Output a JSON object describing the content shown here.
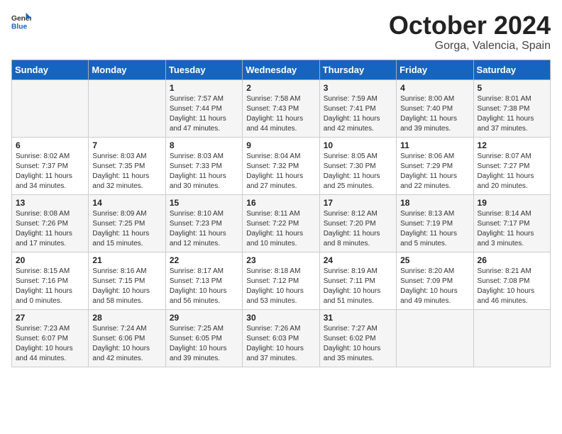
{
  "header": {
    "logo_general": "General",
    "logo_blue": "Blue",
    "month": "October 2024",
    "location": "Gorga, Valencia, Spain"
  },
  "weekdays": [
    "Sunday",
    "Monday",
    "Tuesday",
    "Wednesday",
    "Thursday",
    "Friday",
    "Saturday"
  ],
  "weeks": [
    [
      {
        "day": "",
        "content": ""
      },
      {
        "day": "",
        "content": ""
      },
      {
        "day": "1",
        "content": "Sunrise: 7:57 AM\nSunset: 7:44 PM\nDaylight: 11 hours and 47 minutes."
      },
      {
        "day": "2",
        "content": "Sunrise: 7:58 AM\nSunset: 7:43 PM\nDaylight: 11 hours and 44 minutes."
      },
      {
        "day": "3",
        "content": "Sunrise: 7:59 AM\nSunset: 7:41 PM\nDaylight: 11 hours and 42 minutes."
      },
      {
        "day": "4",
        "content": "Sunrise: 8:00 AM\nSunset: 7:40 PM\nDaylight: 11 hours and 39 minutes."
      },
      {
        "day": "5",
        "content": "Sunrise: 8:01 AM\nSunset: 7:38 PM\nDaylight: 11 hours and 37 minutes."
      }
    ],
    [
      {
        "day": "6",
        "content": "Sunrise: 8:02 AM\nSunset: 7:37 PM\nDaylight: 11 hours and 34 minutes."
      },
      {
        "day": "7",
        "content": "Sunrise: 8:03 AM\nSunset: 7:35 PM\nDaylight: 11 hours and 32 minutes."
      },
      {
        "day": "8",
        "content": "Sunrise: 8:03 AM\nSunset: 7:33 PM\nDaylight: 11 hours and 30 minutes."
      },
      {
        "day": "9",
        "content": "Sunrise: 8:04 AM\nSunset: 7:32 PM\nDaylight: 11 hours and 27 minutes."
      },
      {
        "day": "10",
        "content": "Sunrise: 8:05 AM\nSunset: 7:30 PM\nDaylight: 11 hours and 25 minutes."
      },
      {
        "day": "11",
        "content": "Sunrise: 8:06 AM\nSunset: 7:29 PM\nDaylight: 11 hours and 22 minutes."
      },
      {
        "day": "12",
        "content": "Sunrise: 8:07 AM\nSunset: 7:27 PM\nDaylight: 11 hours and 20 minutes."
      }
    ],
    [
      {
        "day": "13",
        "content": "Sunrise: 8:08 AM\nSunset: 7:26 PM\nDaylight: 11 hours and 17 minutes."
      },
      {
        "day": "14",
        "content": "Sunrise: 8:09 AM\nSunset: 7:25 PM\nDaylight: 11 hours and 15 minutes."
      },
      {
        "day": "15",
        "content": "Sunrise: 8:10 AM\nSunset: 7:23 PM\nDaylight: 11 hours and 12 minutes."
      },
      {
        "day": "16",
        "content": "Sunrise: 8:11 AM\nSunset: 7:22 PM\nDaylight: 11 hours and 10 minutes."
      },
      {
        "day": "17",
        "content": "Sunrise: 8:12 AM\nSunset: 7:20 PM\nDaylight: 11 hours and 8 minutes."
      },
      {
        "day": "18",
        "content": "Sunrise: 8:13 AM\nSunset: 7:19 PM\nDaylight: 11 hours and 5 minutes."
      },
      {
        "day": "19",
        "content": "Sunrise: 8:14 AM\nSunset: 7:17 PM\nDaylight: 11 hours and 3 minutes."
      }
    ],
    [
      {
        "day": "20",
        "content": "Sunrise: 8:15 AM\nSunset: 7:16 PM\nDaylight: 11 hours and 0 minutes."
      },
      {
        "day": "21",
        "content": "Sunrise: 8:16 AM\nSunset: 7:15 PM\nDaylight: 10 hours and 58 minutes."
      },
      {
        "day": "22",
        "content": "Sunrise: 8:17 AM\nSunset: 7:13 PM\nDaylight: 10 hours and 56 minutes."
      },
      {
        "day": "23",
        "content": "Sunrise: 8:18 AM\nSunset: 7:12 PM\nDaylight: 10 hours and 53 minutes."
      },
      {
        "day": "24",
        "content": "Sunrise: 8:19 AM\nSunset: 7:11 PM\nDaylight: 10 hours and 51 minutes."
      },
      {
        "day": "25",
        "content": "Sunrise: 8:20 AM\nSunset: 7:09 PM\nDaylight: 10 hours and 49 minutes."
      },
      {
        "day": "26",
        "content": "Sunrise: 8:21 AM\nSunset: 7:08 PM\nDaylight: 10 hours and 46 minutes."
      }
    ],
    [
      {
        "day": "27",
        "content": "Sunrise: 7:23 AM\nSunset: 6:07 PM\nDaylight: 10 hours and 44 minutes."
      },
      {
        "day": "28",
        "content": "Sunrise: 7:24 AM\nSunset: 6:06 PM\nDaylight: 10 hours and 42 minutes."
      },
      {
        "day": "29",
        "content": "Sunrise: 7:25 AM\nSunset: 6:05 PM\nDaylight: 10 hours and 39 minutes."
      },
      {
        "day": "30",
        "content": "Sunrise: 7:26 AM\nSunset: 6:03 PM\nDaylight: 10 hours and 37 minutes."
      },
      {
        "day": "31",
        "content": "Sunrise: 7:27 AM\nSunset: 6:02 PM\nDaylight: 10 hours and 35 minutes."
      },
      {
        "day": "",
        "content": ""
      },
      {
        "day": "",
        "content": ""
      }
    ]
  ]
}
